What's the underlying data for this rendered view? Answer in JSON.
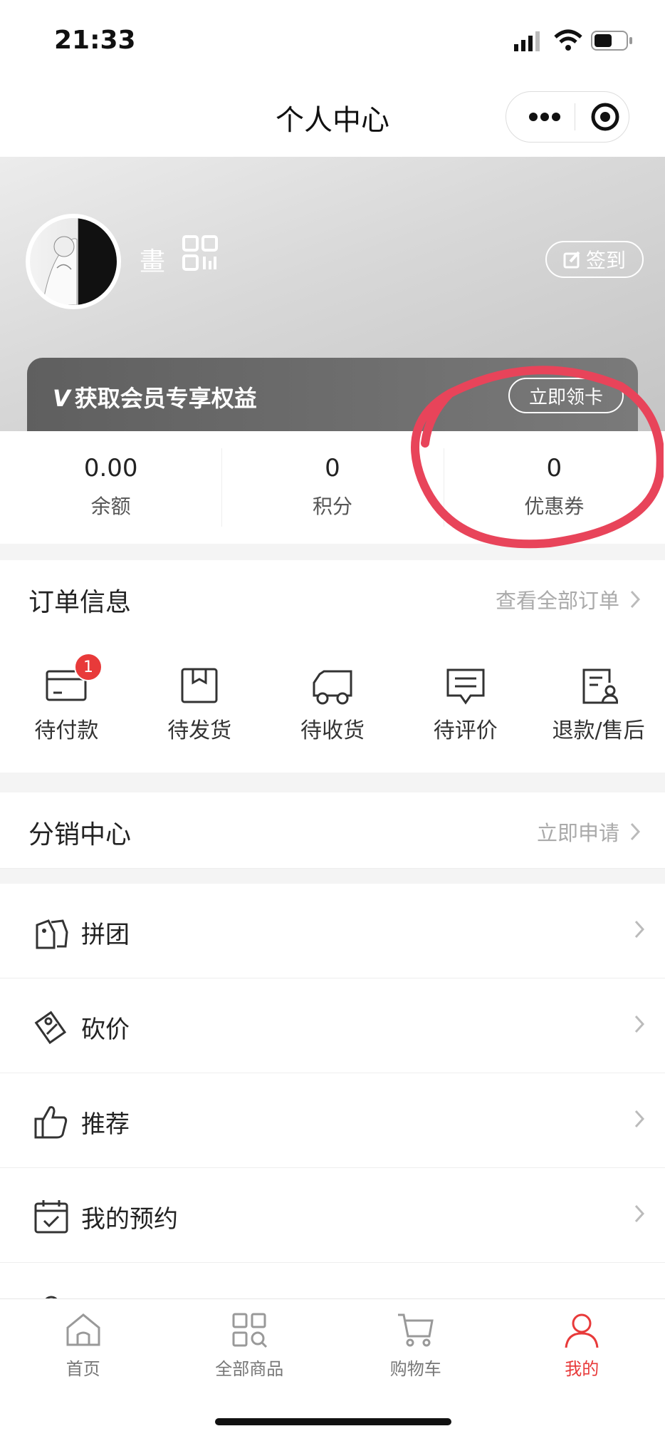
{
  "status": {
    "time": "21:33"
  },
  "nav": {
    "title": "个人中心"
  },
  "profile": {
    "name": "畫",
    "signin_label": "签到"
  },
  "member": {
    "mark": "V",
    "text": "获取会员专享权益",
    "button": "立即领卡"
  },
  "stats": [
    {
      "value": "0.00",
      "label": "余额"
    },
    {
      "value": "0",
      "label": "积分"
    },
    {
      "value": "0",
      "label": "优惠券"
    }
  ],
  "orders": {
    "title": "订单信息",
    "link": "查看全部订单",
    "items": [
      {
        "label": "待付款",
        "icon": "card-icon",
        "badge": "1"
      },
      {
        "label": "待发货",
        "icon": "box-icon"
      },
      {
        "label": "待收货",
        "icon": "truck-icon"
      },
      {
        "label": "待评价",
        "icon": "comment-icon"
      },
      {
        "label": "退款/售后",
        "icon": "refund-icon"
      }
    ]
  },
  "distribution": {
    "title": "分销中心",
    "link": "立即申请"
  },
  "menu": [
    {
      "label": "拼团",
      "icon": "group-tag-icon"
    },
    {
      "label": "砍价",
      "icon": "discount-tag-icon"
    },
    {
      "label": "推荐",
      "icon": "thumbs-up-icon"
    },
    {
      "label": "我的预约",
      "icon": "calendar-check-icon"
    }
  ],
  "tabs": [
    {
      "label": "首页",
      "icon": "home-icon"
    },
    {
      "label": "全部商品",
      "icon": "grid-search-icon"
    },
    {
      "label": "购物车",
      "icon": "cart-icon"
    },
    {
      "label": "我的",
      "icon": "user-icon",
      "active": true
    }
  ],
  "colors": {
    "accent": "#e83a3a",
    "annotation": "#e8445a"
  }
}
